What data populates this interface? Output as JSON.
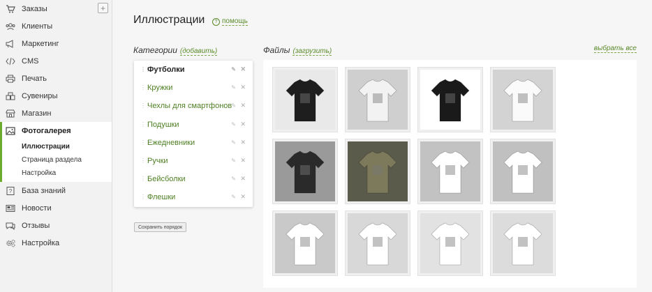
{
  "sidebar": {
    "items": [
      {
        "label": "Заказы",
        "icon": "cart-icon"
      },
      {
        "label": "Клиенты",
        "icon": "users-icon"
      },
      {
        "label": "Маркетинг",
        "icon": "megaphone-icon"
      },
      {
        "label": "CMS",
        "icon": "code-icon"
      },
      {
        "label": "Печать",
        "icon": "printer-icon"
      },
      {
        "label": "Сувениры",
        "icon": "boxes-icon"
      },
      {
        "label": "Магазин",
        "icon": "store-icon"
      },
      {
        "label": "Фотогалерея",
        "icon": "image-icon"
      },
      {
        "label": "База знаний",
        "icon": "question-icon"
      },
      {
        "label": "Новости",
        "icon": "newspaper-icon"
      },
      {
        "label": "Отзывы",
        "icon": "chat-icon"
      },
      {
        "label": "Настройка",
        "icon": "gears-icon"
      }
    ],
    "sub_items": [
      "Иллюстрации",
      "Страница раздела",
      "Настройка"
    ],
    "plus": "+"
  },
  "page": {
    "title": "Иллюстрации",
    "help": "помощь",
    "help_mark": "?"
  },
  "categories": {
    "heading": "Категории",
    "add_link": "(добавить)",
    "items": [
      "Футболки",
      "Кружки",
      "Чехлы для смартфонов",
      "Подушки",
      "Ежедневники",
      "Ручки",
      "Бейсболки",
      "Флешки"
    ],
    "edit_glyph": "✎",
    "delete_glyph": "✕",
    "save_order": "Сохранить порядок"
  },
  "files": {
    "heading": "Файлы",
    "upload_link": "(загрузить)",
    "select_all": "выбрать все",
    "thumbnails": [
      {
        "bg": "#e9e9e9",
        "shirt": "#1e1e1e"
      },
      {
        "bg": "#cfcfcf",
        "shirt": "#f2f2f2"
      },
      {
        "bg": "#ffffff",
        "shirt": "#1a1a1a"
      },
      {
        "bg": "#d3d3d3",
        "shirt": "#fafafa"
      },
      {
        "bg": "#9a9a9a",
        "shirt": "#2a2a2a"
      },
      {
        "bg": "#5b5b4c",
        "shirt": "#7d7a5c"
      },
      {
        "bg": "#c2c2c2",
        "shirt": "#ffffff"
      },
      {
        "bg": "#c0c0c0",
        "shirt": "#ffffff"
      },
      {
        "bg": "#c9c9c9",
        "shirt": "#ffffff"
      },
      {
        "bg": "#d8d8d8",
        "shirt": "#ffffff"
      },
      {
        "bg": "#e2e2e2",
        "shirt": "#ffffff"
      },
      {
        "bg": "#dcdcdc",
        "shirt": "#ffffff"
      }
    ]
  },
  "colors": {
    "accent": "#6aab2e",
    "link": "#5a8a2a"
  }
}
